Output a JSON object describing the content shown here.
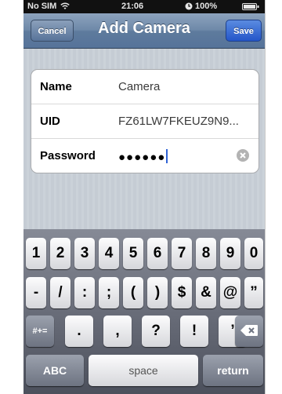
{
  "status_bar": {
    "carrier": "No SIM",
    "time": "21:06",
    "battery": "100%"
  },
  "nav_bar": {
    "title": "Add Camera",
    "cancel_label": "Cancel",
    "save_label": "Save"
  },
  "form": {
    "fields": [
      {
        "label": "Name",
        "value": "Camera"
      },
      {
        "label": "UID",
        "value": "FZ61LW7FKEUZ9N9..."
      },
      {
        "label": "Password",
        "value": "●●●●●●"
      }
    ]
  },
  "keyboard": {
    "row1": [
      "1",
      "2",
      "3",
      "4",
      "5",
      "6",
      "7",
      "8",
      "9",
      "0"
    ],
    "row2": [
      "-",
      "/",
      ":",
      ";",
      "(",
      ")",
      "$",
      "&",
      "@",
      "”"
    ],
    "row3": {
      "toggle": "#+=",
      "keys": [
        ".",
        ",",
        "?",
        "!",
        "’"
      ]
    },
    "row4": {
      "abc": "ABC",
      "space": "space",
      "return": "return"
    }
  }
}
